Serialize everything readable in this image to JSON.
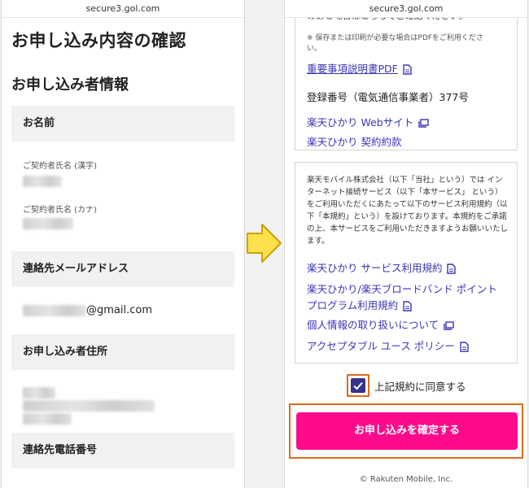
{
  "left_phone": {
    "url": "secure3.gol.com",
    "page_title": "お申し込み内容の確認",
    "section_title": "お申し込み者情報",
    "fields": [
      {
        "header": "お名前"
      },
      {
        "header": "連絡先メールアドレス"
      },
      {
        "header": "お申し込み者住所"
      },
      {
        "header": "連絡先電話番号"
      }
    ],
    "name_kanji_label": "ご契約者氏名 (漢字)",
    "name_kana_label": "ご契約者氏名 (カナ)",
    "email_suffix": "@gmail.com"
  },
  "right_phone": {
    "url": "secure3.gol.com",
    "cut_text": "のあと場合はこちらでご確認ください。",
    "save_note_1": "※ 保存または印刷が必要な場合はPDFをご利用くださ",
    "save_note_2": "い。",
    "pdf_link": "重要事項説明書PDF",
    "registration": "登録番号（電気通信事業者）377号",
    "website_link": "楽天ひかり Webサイト",
    "contract_link_cut": "楽天ひかり 契約約款",
    "terms_text": "楽天モバイル株式会社（以下「当社」という）では インターネット接続サービス（以下「本サービス」 という）をご利用いただくにあたって以下のサービス利用規約（以下「本規約」という）を設けております。本規約をご承諾の上、本サービスをご利用いただきますようお願いいたします。",
    "links": [
      {
        "line1": "楽天ひかり サービス利用規約",
        "line2": ""
      },
      {
        "line1": "楽天ひかり/楽天ブロードバンド ポイント",
        "line2": "プログラム利用規約"
      },
      {
        "line1": "個人情報の取り扱いについて",
        "line2": ""
      },
      {
        "line1": "アクセプタブル ユース ポリシー",
        "line2": ""
      }
    ],
    "consent_label": "上記規約に同意する",
    "consent_checked": true,
    "confirm_button": "お申し込みを確定する",
    "footer": "© Rakuten Mobile, Inc."
  },
  "colors": {
    "accent": "#3a35b8",
    "button": "#ff0a8a",
    "highlight": "#e06a1b",
    "arrow": "#ffe14d"
  }
}
